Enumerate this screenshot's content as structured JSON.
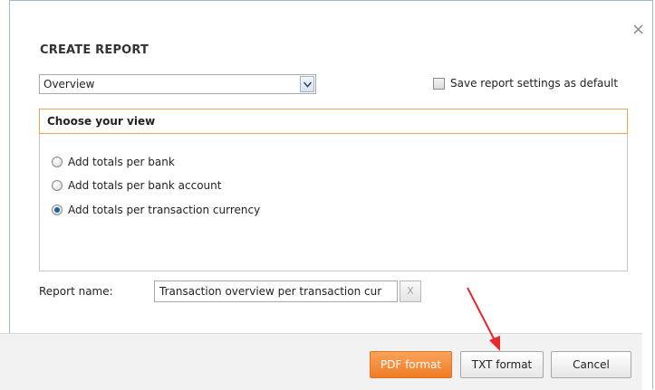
{
  "dialog": {
    "title": "CREATE REPORT",
    "close_label": "×"
  },
  "report_type": {
    "selected": "Overview"
  },
  "save_default": {
    "label": "Save report settings as default",
    "checked": false
  },
  "view": {
    "header": "Choose your view",
    "options": [
      {
        "label": "Add totals per bank",
        "checked": false
      },
      {
        "label": "Add totals per bank account",
        "checked": false
      },
      {
        "label": "Add totals per transaction currency",
        "checked": true
      }
    ]
  },
  "report_name": {
    "label": "Report name:",
    "value": "Transaction overview per transaction cur",
    "clear_label": "X"
  },
  "buttons": {
    "pdf": "PDF format",
    "txt": "TXT format",
    "cancel": "Cancel"
  },
  "colors": {
    "accent_orange": "#f07c25",
    "annotation_arrow": "#e8282b"
  }
}
